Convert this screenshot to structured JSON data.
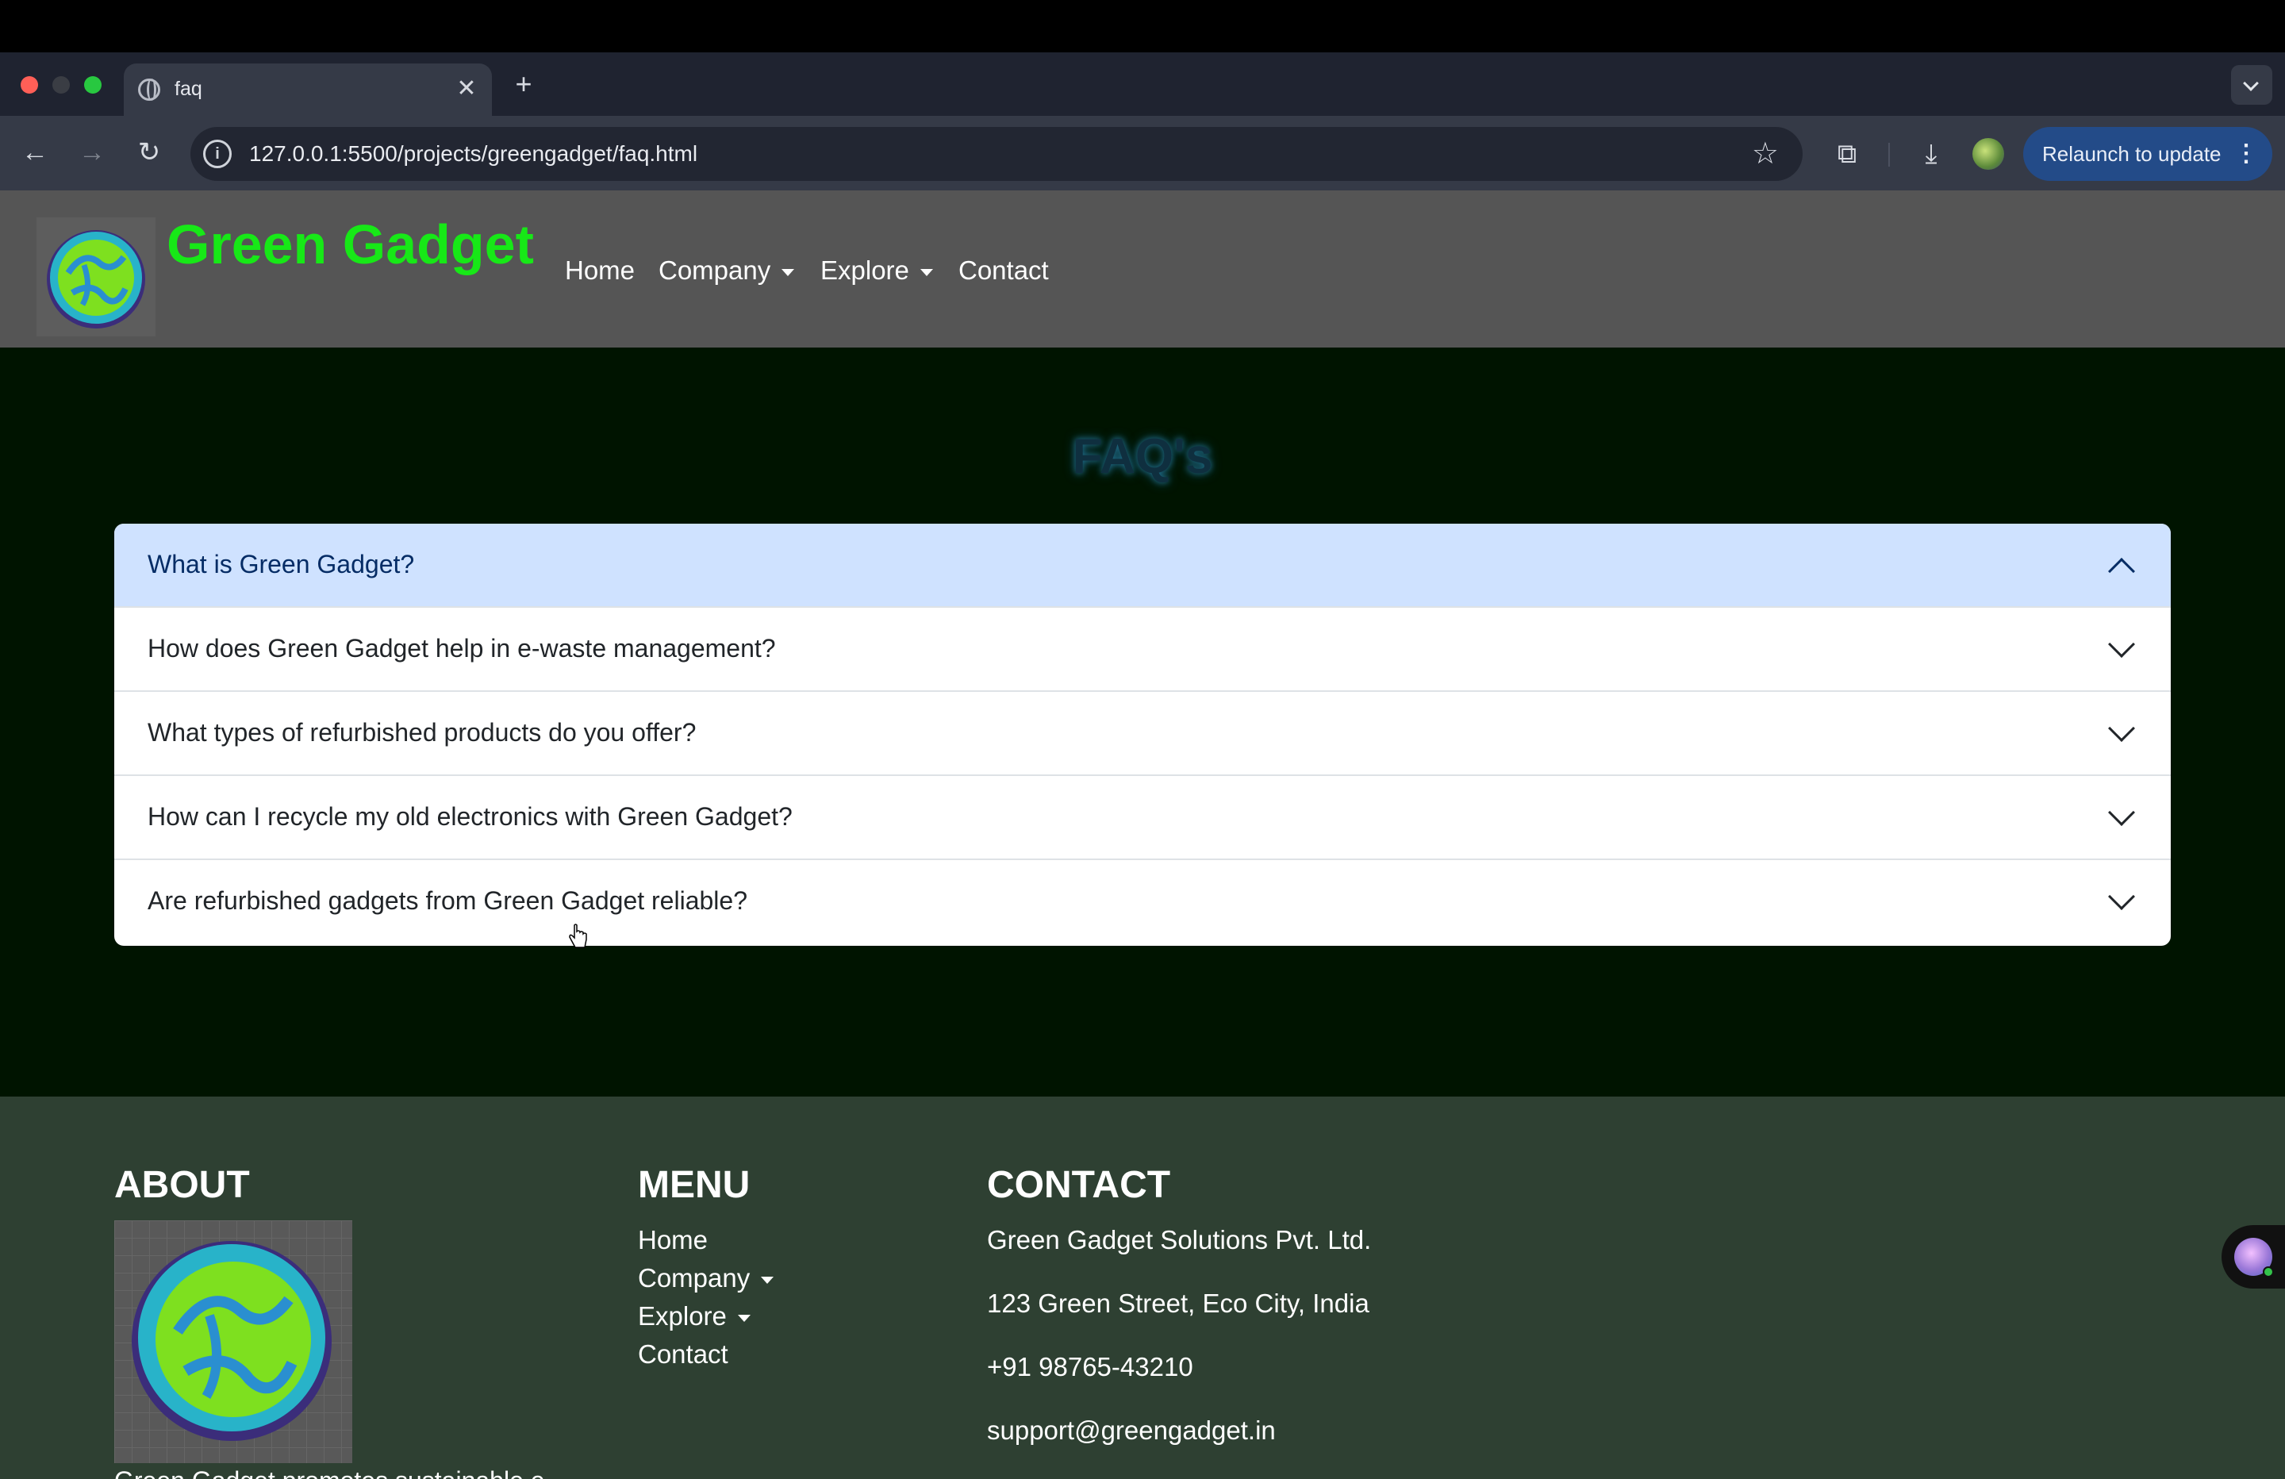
{
  "browser": {
    "tab_title": "faq",
    "url": "127.0.0.1:5500/projects/greengadget/faq.html",
    "relaunch_label": "Relaunch to update"
  },
  "header": {
    "brand": "Green Gadget",
    "nav": {
      "home": "Home",
      "company": "Company",
      "explore": "Explore",
      "contact": "Contact"
    }
  },
  "faq": {
    "title": "FAQ's",
    "items": [
      {
        "question": "What is Green Gadget?",
        "expanded": true
      },
      {
        "question": "How does Green Gadget help in e-waste management?",
        "expanded": false
      },
      {
        "question": "What types of refurbished products do you offer?",
        "expanded": false
      },
      {
        "question": "How can I recycle my old electronics with Green Gadget?",
        "expanded": false
      },
      {
        "question": "Are refurbished gadgets from Green Gadget reliable?",
        "expanded": false
      }
    ]
  },
  "footer": {
    "about_heading": "ABOUT",
    "about_text": "Green Gadget promotes sustainable e",
    "menu_heading": "MENU",
    "menu": [
      "Home",
      "Company",
      "Explore",
      "Contact"
    ],
    "contact_heading": "CONTACT",
    "contact": [
      "Green Gadget Solutions Pvt. Ltd.",
      "123 Green Street, Eco City, India",
      "+91 98765-43210",
      "support@greengadget.in"
    ]
  },
  "colors": {
    "brand_green": "#17e817",
    "header_bg": "#555555",
    "main_bg": "#001400",
    "footer_bg": "#2e4032",
    "accordion_active_bg": "#cfe2ff",
    "relaunch_bg": "#234b88"
  },
  "icons": [
    "globe-icon",
    "close-icon",
    "plus-icon",
    "back-icon",
    "forward-icon",
    "reload-icon",
    "info-icon",
    "star-icon",
    "extensions-icon",
    "download-icon",
    "more-icon",
    "chevron-down-icon",
    "chevron-up-icon",
    "caret-down-icon",
    "hand-cursor-icon"
  ]
}
